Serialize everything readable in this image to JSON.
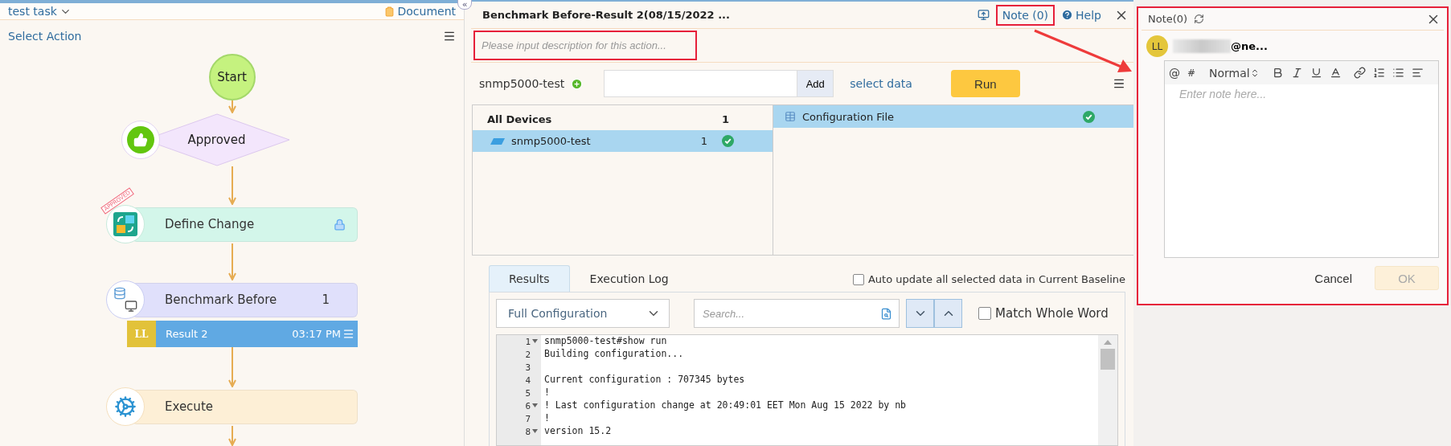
{
  "left_panel": {
    "task_name": "test task",
    "document_link": "Document",
    "select_action": "Select Action",
    "flow_nodes": [
      {
        "kind": "start",
        "label": "Start"
      },
      {
        "kind": "decision",
        "label": "Approved"
      },
      {
        "kind": "define",
        "label": "Define Change",
        "color": "#d3f6ea",
        "stamp": "APPROVED",
        "locked": true
      },
      {
        "kind": "benchmark",
        "label": "Benchmark Before",
        "color": "#e0e0fb",
        "count": "1",
        "result": {
          "initials": "LL",
          "label": "Result 2",
          "time": "03:17 PM"
        }
      },
      {
        "kind": "execute",
        "label": "Execute",
        "color": "#fdefd6"
      }
    ]
  },
  "collapse_toggle": "«",
  "action_panel": {
    "title": "Benchmark Before-Result 2(08/15/2022 ...",
    "note_link": "Note (0)",
    "help_link": "Help",
    "description_placeholder": "Please input description for this action...",
    "device_label": "snmp5000-test",
    "add_button": "Add",
    "select_data": "select data",
    "run_button": "Run",
    "devices": {
      "header": "All Devices",
      "header_count": "1",
      "items": [
        {
          "name": "snmp5000-test",
          "count": "1",
          "selected": true,
          "done": true
        }
      ]
    },
    "data_items": [
      {
        "name": "Configuration File",
        "selected": true,
        "done": true
      }
    ],
    "tabs": [
      {
        "label": "Results",
        "selected": true
      },
      {
        "label": "Execution Log",
        "selected": false
      }
    ],
    "auto_update": {
      "label": "Auto update all selected data in Current Baseline",
      "checked": false
    },
    "view_select": "Full Configuration",
    "search_placeholder": "Search...",
    "match_whole_word": {
      "label": "Match Whole Word",
      "checked": false
    },
    "code_lines": [
      {
        "number": "1",
        "text": "snmp5000-test#show run",
        "foldable": true
      },
      {
        "number": "2",
        "text": "Building configuration...",
        "foldable": false
      },
      {
        "number": "3",
        "foldable": false
      },
      {
        "number": "4",
        "text": "Current configuration : 707345 bytes",
        "foldable": false
      },
      {
        "number": "5",
        "text": "!",
        "foldable": false
      },
      {
        "number": "6",
        "text": "! Last configuration change at 20:49:01 EET Mon Aug 15 2022 by nb",
        "foldable": true
      },
      {
        "number": "7",
        "text": "!",
        "foldable": false
      },
      {
        "number": "8",
        "text": "version 15.2",
        "foldable": true
      }
    ]
  },
  "note_panel": {
    "title": "Note(0)",
    "avatar": "LL",
    "user": "@ne...",
    "mention_key": "@",
    "tag_key": "#",
    "format_select": "Normal",
    "editor_placeholder": "Enter note here...",
    "cancel_button": "Cancel",
    "ok_button": "OK",
    "ok_disabled": true
  }
}
